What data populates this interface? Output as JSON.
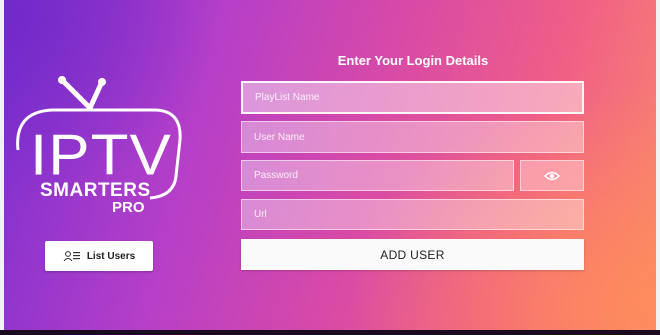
{
  "logo": {
    "main": "IPTV",
    "line1": "SMARTERS",
    "line2": "PRO"
  },
  "form": {
    "title": "Enter Your Login Details",
    "playlist_placeholder": "PlayList Name",
    "username_placeholder": "User Name",
    "password_placeholder": "Password",
    "url_placeholder": "Url",
    "add_user_label": "ADD USER"
  },
  "list_users": {
    "label": "List Users",
    "icon": "users-icon"
  },
  "icons": {
    "password_toggle": "eye-icon"
  }
}
